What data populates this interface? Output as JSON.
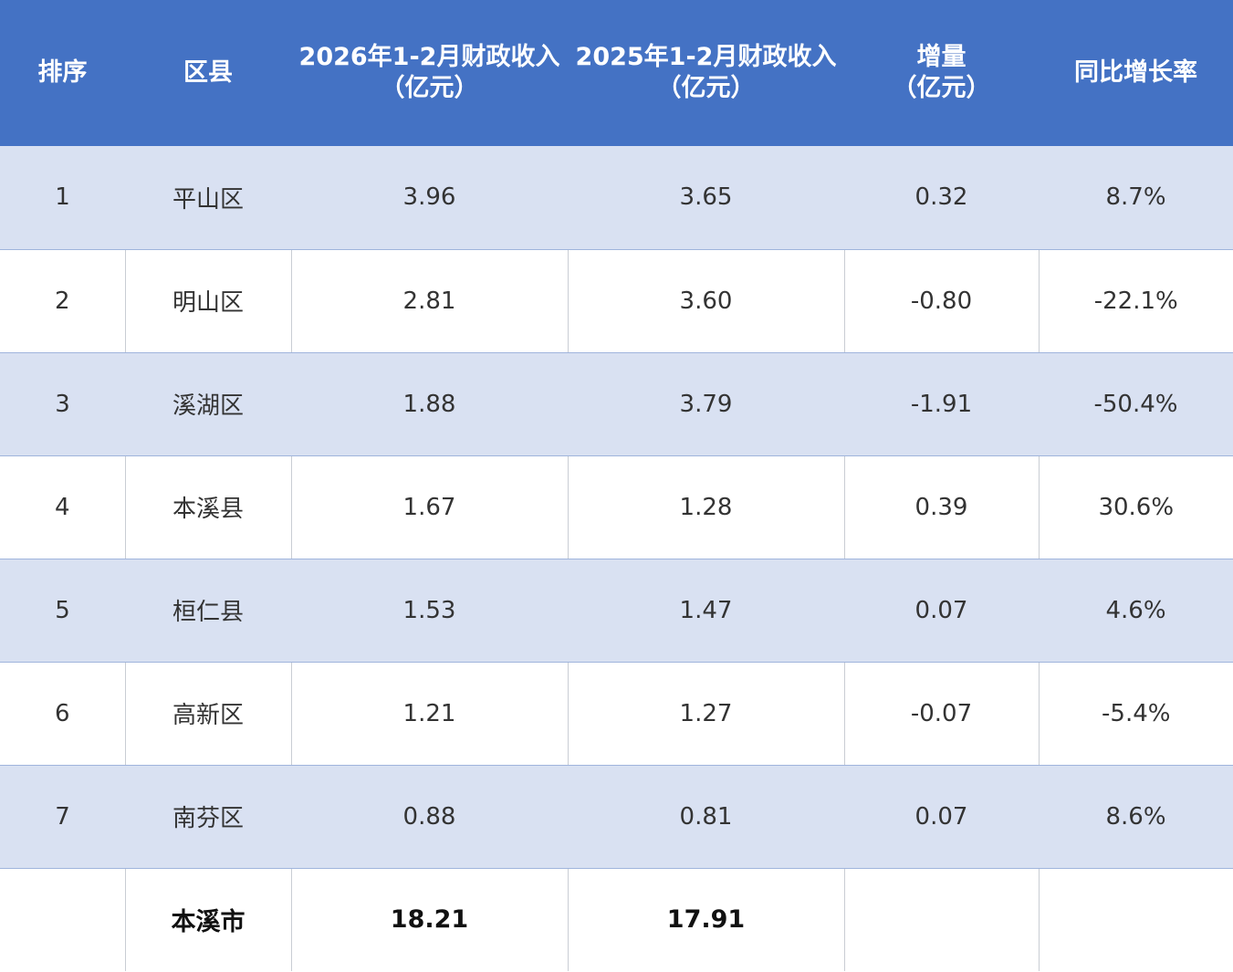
{
  "header": {
    "col_rank": "排序",
    "col_district": "区县",
    "col_2026": {
      "line1": "2026年1-2月财政收入",
      "line2": "（亿元）"
    },
    "col_2025": {
      "line1": "2025年1-2月财政收入",
      "line2": "（亿元）"
    },
    "col_increase": {
      "line1": "增量",
      "line2": "（亿元）"
    },
    "col_growth": "同比增长率"
  },
  "rows": [
    {
      "rank": "1",
      "district": "平山区",
      "rev_2026": "3.96",
      "rev_2025": "3.65",
      "increase": "0.32",
      "growth": "8.7%"
    },
    {
      "rank": "2",
      "district": "明山区",
      "rev_2026": "2.81",
      "rev_2025": "3.60",
      "increase": "-0.80",
      "growth": "-22.1%"
    },
    {
      "rank": "3",
      "district": "溪湖区",
      "rev_2026": "1.88",
      "rev_2025": "3.79",
      "increase": "-1.91",
      "growth": "-50.4%"
    },
    {
      "rank": "4",
      "district": "本溪县",
      "rev_2026": "1.67",
      "rev_2025": "1.28",
      "increase": "0.39",
      "growth": "30.6%"
    },
    {
      "rank": "5",
      "district": "桓仁县",
      "rev_2026": "1.53",
      "rev_2025": "1.47",
      "increase": "0.07",
      "growth": "4.6%"
    },
    {
      "rank": "6",
      "district": "高新区",
      "rev_2026": "1.21",
      "rev_2025": "1.27",
      "increase": "-0.07",
      "growth": "-5.4%"
    },
    {
      "rank": "7",
      "district": "南芬区",
      "rev_2026": "0.88",
      "rev_2025": "0.81",
      "increase": "0.07",
      "growth": "8.6%"
    }
  ],
  "total": {
    "rank": "",
    "district": "本溪市",
    "rev_2026": "18.21",
    "rev_2025": "17.91",
    "increase": "",
    "growth": ""
  },
  "colors": {
    "header_bg": "#4472c4",
    "header_text": "#ffffff",
    "band_row": "#d9e1f2",
    "plain_row": "#ffffff"
  }
}
